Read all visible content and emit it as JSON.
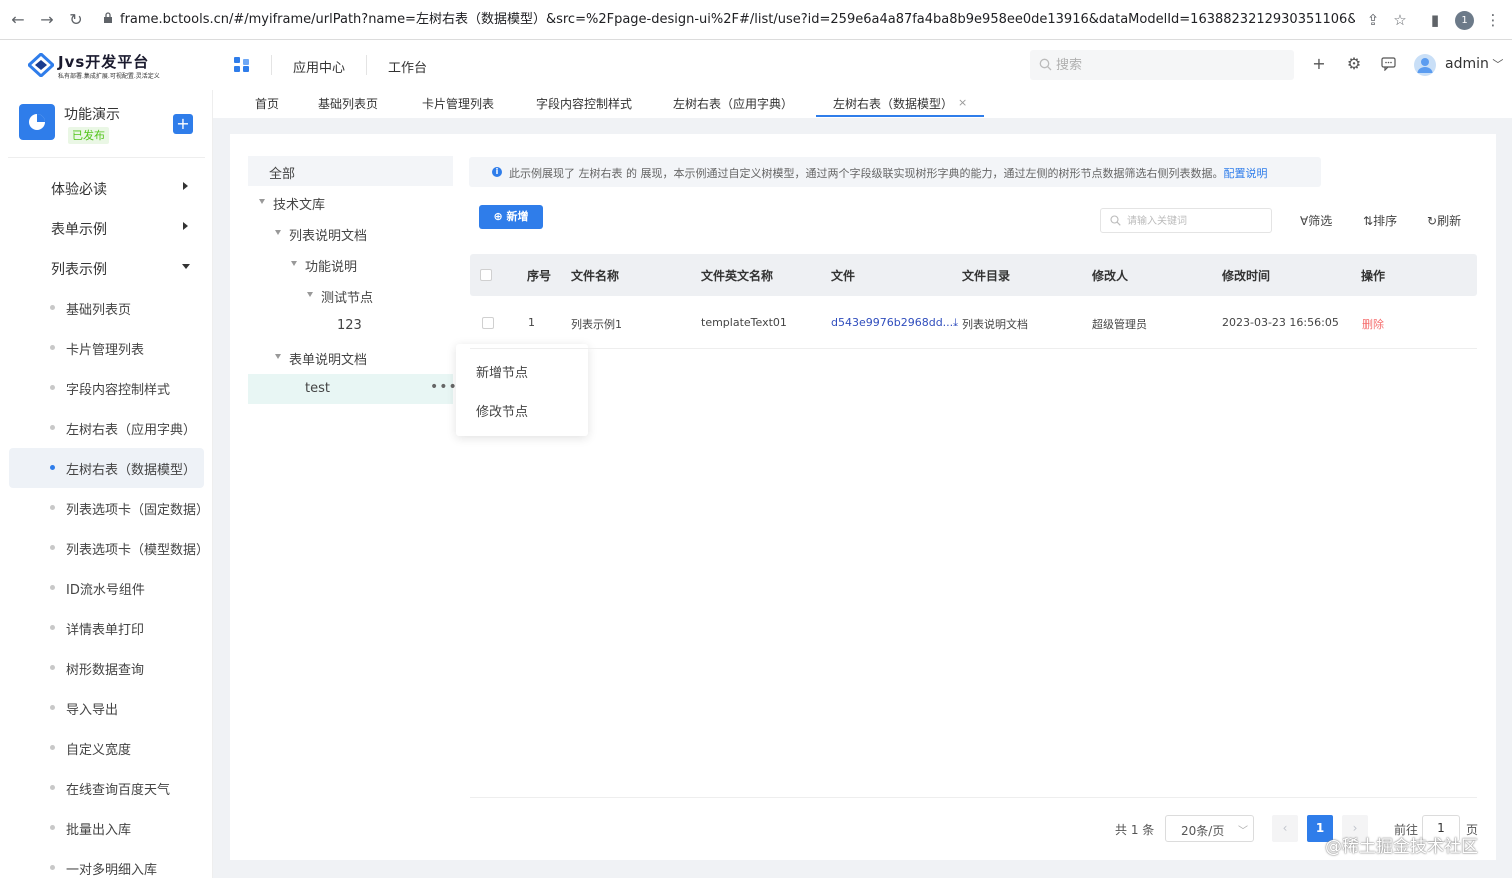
{
  "browser": {
    "url": "frame.bctools.cn/#/myiframe/urlPath?name=左树右表（数据模型）&src=%2Fpage-design-ui%2F#/list/use?id=259e6a4a87fa4ba8b9e958ee0de13916&dataModelId=1638823212930351106&jvsAppId=9833...",
    "profile_initial": "1"
  },
  "header": {
    "logo_title": "Jvs开发平台",
    "logo_subtitle": "私有部署.集成扩展.可视配置.灵活定义",
    "links": [
      "应用中心",
      "工作台"
    ],
    "search_placeholder": "搜索",
    "username": "admin"
  },
  "sidebar": {
    "app_name": "功能演示",
    "app_status": "已发布",
    "groups": [
      {
        "label": "体验必读"
      },
      {
        "label": "表单示例"
      },
      {
        "label": "列表示例"
      }
    ],
    "items": [
      {
        "label": "基础列表页"
      },
      {
        "label": "卡片管理列表"
      },
      {
        "label": "字段内容控制样式"
      },
      {
        "label": "左树右表（应用字典）"
      },
      {
        "label": "左树右表（数据模型）"
      },
      {
        "label": "列表选项卡（固定数据）"
      },
      {
        "label": "列表选项卡（模型数据）"
      },
      {
        "label": "ID流水号组件"
      },
      {
        "label": "详情表单打印"
      },
      {
        "label": "树形数据查询"
      },
      {
        "label": "导入导出"
      },
      {
        "label": "自定义宽度"
      },
      {
        "label": "在线查询百度天气"
      },
      {
        "label": "批量出入库"
      },
      {
        "label": "一对多明细入库"
      }
    ]
  },
  "tabs": [
    "首页",
    "基础列表页",
    "卡片管理列表",
    "字段内容控制样式",
    "左树右表（应用字典）",
    "左树右表（数据模型）"
  ],
  "tree": {
    "all": "全部",
    "nodes": [
      "技术文库",
      "列表说明文档",
      "功能说明",
      "测试节点",
      "123",
      "表单说明文档",
      "test"
    ],
    "more": "•••"
  },
  "context_menu": [
    "新增节点",
    "修改节点"
  ],
  "info": {
    "text": "此示例展现了 左树右表 的 展现，本示例通过自定义树模型，通过两个字段级联实现树形字典的能力，通过左侧的树形节点数据筛选右侧列表数据。",
    "link": "配置说明"
  },
  "toolbar": {
    "new_label": "新增",
    "keyword_placeholder": "请输入关键词",
    "filter": "筛选",
    "sort": "排序",
    "refresh": "刷新"
  },
  "table": {
    "headers": [
      "序号",
      "文件名称",
      "文件英文名称",
      "文件",
      "文件目录",
      "修改人",
      "修改时间",
      "操作"
    ],
    "rows": [
      {
        "index": "1",
        "name": "列表示例1",
        "en_name": "templateText01",
        "file": "d543e9976b2968dd...",
        "dir": "列表说明文档",
        "modifier": "超级管理员",
        "time": "2023-03-23 16:56:05",
        "action": "删除"
      }
    ]
  },
  "pager": {
    "total": "共 1 条",
    "size": "20条/页",
    "current": "1",
    "goto": "前往",
    "goto_value": "1",
    "page_unit": "页"
  },
  "watermark": "@稀土掘金技术社区"
}
